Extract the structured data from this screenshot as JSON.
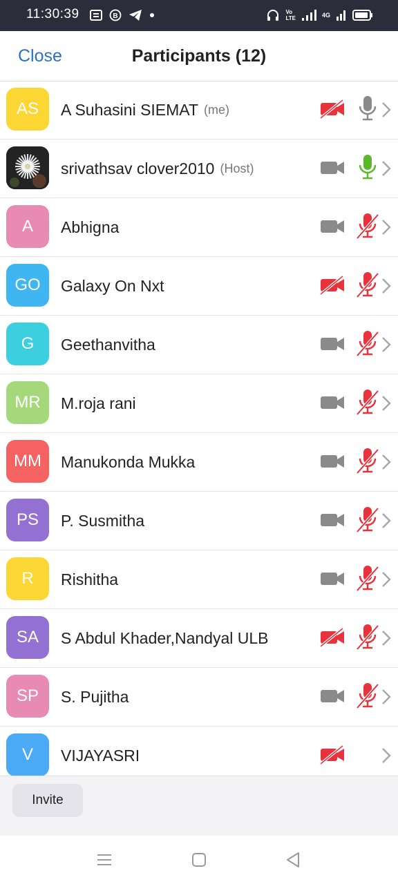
{
  "status_bar": {
    "time": "11:30:39",
    "network_label_top": "Vo",
    "network_label_bottom": "LTE",
    "network_type": "4G"
  },
  "header": {
    "close_label": "Close",
    "title": "Participants (12)"
  },
  "participants": [
    {
      "initials": "AS",
      "name": "A Suhasini SIEMAT",
      "tag": "(me)",
      "avatar_color": "#fcd632",
      "video": "off",
      "mic": "on-gray"
    },
    {
      "initials": "",
      "name": "srivathsav clover2010",
      "tag": "(Host)",
      "avatar_color": "#2a2a2a",
      "video": "on",
      "mic": "on-green"
    },
    {
      "initials": "A",
      "name": "Abhigna",
      "tag": "",
      "avatar_color": "#e78bb5",
      "video": "on",
      "mic": "muted"
    },
    {
      "initials": "GO",
      "name": "Galaxy On Nxt",
      "tag": "",
      "avatar_color": "#3fb6f2",
      "video": "off",
      "mic": "muted"
    },
    {
      "initials": "G",
      "name": "Geethanvitha",
      "tag": "",
      "avatar_color": "#3ccfe0",
      "video": "on",
      "mic": "muted"
    },
    {
      "initials": "MR",
      "name": "M.roja rani",
      "tag": "",
      "avatar_color": "#a5d87a",
      "video": "on",
      "mic": "muted"
    },
    {
      "initials": "MM",
      "name": "Manukonda Mukka",
      "tag": "",
      "avatar_color": "#f56262",
      "video": "on",
      "mic": "muted"
    },
    {
      "initials": "PS",
      "name": "P. Susmitha",
      "tag": "",
      "avatar_color": "#9371d3",
      "video": "on",
      "mic": "muted"
    },
    {
      "initials": "R",
      "name": "Rishitha",
      "tag": "",
      "avatar_color": "#fcd632",
      "video": "on",
      "mic": "muted"
    },
    {
      "initials": "SA",
      "name": "S Abdul Khader,Nandyal ULB",
      "tag": "",
      "avatar_color": "#9371d3",
      "video": "off",
      "mic": "muted"
    },
    {
      "initials": "SP",
      "name": "S. Pujitha",
      "tag": "",
      "avatar_color": "#e78bb5",
      "video": "on",
      "mic": "muted"
    },
    {
      "initials": "V",
      "name": "VIJAYASRI",
      "tag": "",
      "avatar_color": "#4aaaf5",
      "video": "off",
      "mic": "none"
    }
  ],
  "footer": {
    "invite_label": "Invite"
  },
  "colors": {
    "accent": "#2d71c4",
    "icon_gray": "#8a8a8a",
    "muted_red": "#e8323c",
    "mic_active_green": "#5cb82b"
  }
}
